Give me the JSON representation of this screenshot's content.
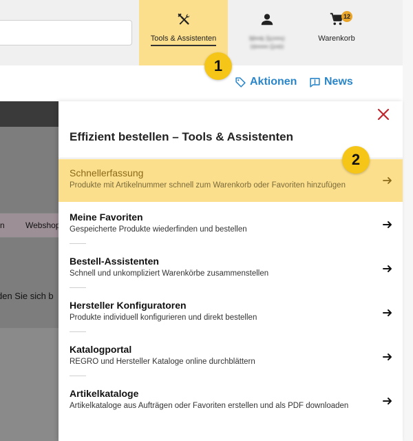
{
  "header": {
    "tools_label": "Tools & Assistenten",
    "account_label_line1": "M•••k Sc••••z",
    "account_label_line2": "H•••••• G••H",
    "cart_label": "Warenkorb",
    "cart_count": "12"
  },
  "subnav": {
    "aktionen": "Aktionen",
    "news": "News"
  },
  "background": {
    "tab_partial": "n",
    "tab_webshop": "Webshop",
    "text_partial": "den Sie sich b"
  },
  "panel": {
    "title": "Effizient bestellen – Tools & Assistenten",
    "items": [
      {
        "title": "Schnellerfassung",
        "desc": "Produkte mit Artikelnummer schnell zum Warenkorb oder Favoriten hinzufügen"
      },
      {
        "title": "Meine Favoriten",
        "desc": "Gespeicherte Produkte wiederfinden und bestellen"
      },
      {
        "title": "Bestell-Assistenten",
        "desc": "Schnell und unkompliziert Warenkörbe zusammenstellen"
      },
      {
        "title": "Hersteller Konfiguratoren",
        "desc": "Produkte individuell konfigurieren und direkt bestellen"
      },
      {
        "title": "Katalogportal",
        "desc": "REGRO und Hersteller Kataloge online durchblättern"
      },
      {
        "title": "Artikelkataloge",
        "desc": "Artikelkataloge aus Aufträgen oder Favoriten erstellen und als PDF downloaden"
      }
    ]
  },
  "callouts": {
    "one": "1",
    "two": "2"
  },
  "colors": {
    "highlight": "#fbdf8c",
    "link": "#2a86c9",
    "close": "#c0272d",
    "callout": "#f5c518"
  }
}
